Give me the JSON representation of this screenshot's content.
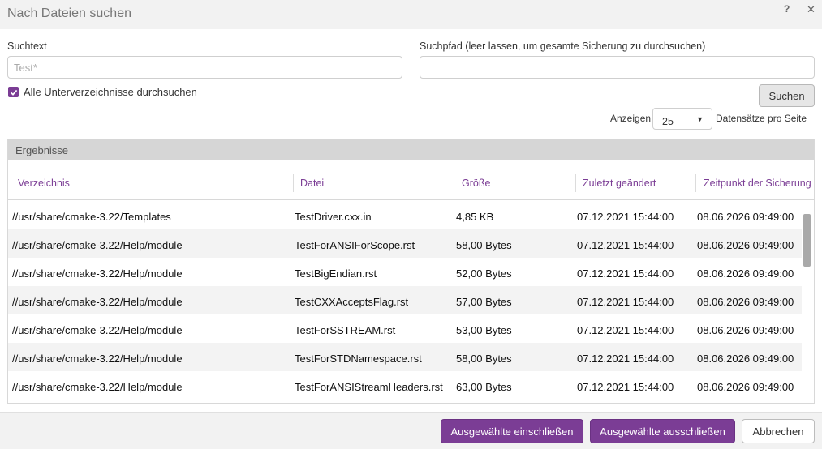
{
  "dialog": {
    "title": "Nach Dateien suchen",
    "help_label": "?",
    "close_label": "✕"
  },
  "search": {
    "text_label": "Suchtext",
    "text_placeholder": "Test*",
    "path_label": "Suchpfad (leer lassen, um gesamte Sicherung zu durchsuchen)",
    "path_value": "",
    "subdirs_label": "Alle Unterverzeichnisse durchsuchen",
    "subdirs_checked": true,
    "search_button": "Suchen"
  },
  "paging": {
    "show_label": "Anzeigen",
    "page_size": "25",
    "per_page_label": "Datensätze pro Seite"
  },
  "results": {
    "title": "Ergebnisse",
    "columns": [
      "Verzeichnis",
      "Datei",
      "Größe",
      "Zuletzt geändert",
      "Zeitpunkt der Sicherung"
    ],
    "rows": [
      [
        "//usr/share/cmake-3.22/Templates",
        "TestDriver.cxx.in",
        "4,85 KB",
        "07.12.2021 15:44:00",
        "08.06.2026 09:49:00"
      ],
      [
        "//usr/share/cmake-3.22/Help/module",
        "TestForANSIForScope.rst",
        "58,00 Bytes",
        "07.12.2021 15:44:00",
        "08.06.2026 09:49:00"
      ],
      [
        "//usr/share/cmake-3.22/Help/module",
        "TestBigEndian.rst",
        "52,00 Bytes",
        "07.12.2021 15:44:00",
        "08.06.2026 09:49:00"
      ],
      [
        "//usr/share/cmake-3.22/Help/module",
        "TestCXXAcceptsFlag.rst",
        "57,00 Bytes",
        "07.12.2021 15:44:00",
        "08.06.2026 09:49:00"
      ],
      [
        "//usr/share/cmake-3.22/Help/module",
        "TestForSSTREAM.rst",
        "53,00 Bytes",
        "07.12.2021 15:44:00",
        "08.06.2026 09:49:00"
      ],
      [
        "//usr/share/cmake-3.22/Help/module",
        "TestForSTDNamespace.rst",
        "58,00 Bytes",
        "07.12.2021 15:44:00",
        "08.06.2026 09:49:00"
      ],
      [
        "//usr/share/cmake-3.22/Help/module",
        "TestForANSIStreamHeaders.rst",
        "63,00 Bytes",
        "07.12.2021 15:44:00",
        "08.06.2026 09:49:00"
      ]
    ]
  },
  "footer": {
    "include_button": "Ausgewählte einschließen",
    "exclude_button": "Ausgewählte ausschließen",
    "cancel_button": "Abbrechen"
  },
  "colors": {
    "accent": "#7b3d95",
    "header_bg": "#d6d6d6",
    "stripe": "#f3f3f3"
  }
}
